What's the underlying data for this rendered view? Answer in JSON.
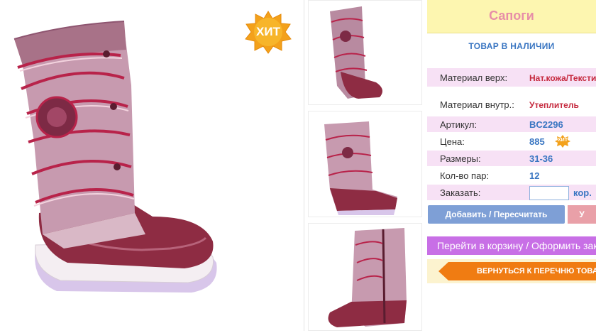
{
  "product": {
    "title": "Сапоги",
    "stock_status": "ТОВАР В НАЛИЧИИ",
    "hit_badge": "ХИТ",
    "mini_hit_badge": "ХИТ"
  },
  "specs": [
    {
      "label": "Материал верх:",
      "value": "Нат.кожа/Текстиль"
    },
    {
      "label": "Материал внутр.:",
      "value": "Утеплитель"
    },
    {
      "label": "Артикул:",
      "value": "BC2296"
    },
    {
      "label": "Цена:",
      "value": "885"
    },
    {
      "label": "Размеры:",
      "value": "31-36"
    },
    {
      "label": "Кол-во пар:",
      "value": "12"
    }
  ],
  "order": {
    "label": "Заказать:",
    "quantity_value": "",
    "unit": "кор."
  },
  "buttons": {
    "add_recalc": "Добавить / Пересчитать",
    "delete": "У",
    "go_cart": "Перейти в корзину / Оформить заказ",
    "back_to_list": "ВЕРНУТЬСЯ К ПЕРЕЧНЮ ТОВАРОВ"
  },
  "colors": {
    "title_bg": "#fdf6b0",
    "title_text": "#e78ea8",
    "accent_blue": "#3a76c2",
    "accent_red": "#c5283d",
    "row_pink": "#f7e1f5",
    "cart_purple": "#c86fe6",
    "back_orange": "#f07c12"
  },
  "icons": {
    "hit_badge": "starburst-badge",
    "back_arrow": "left-arrow"
  }
}
